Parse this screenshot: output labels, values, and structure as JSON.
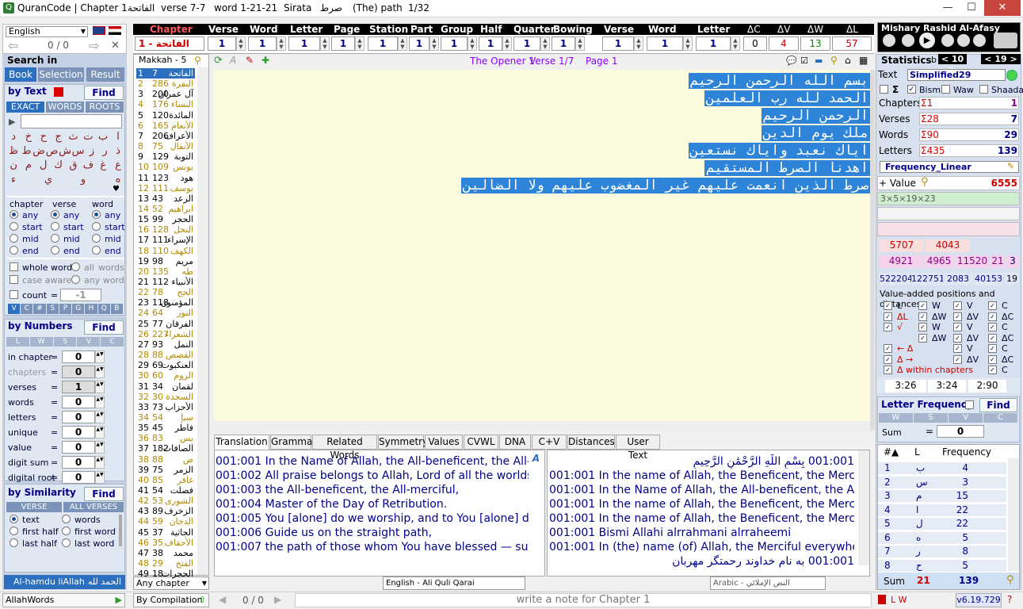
{
  "title": {
    "app": "QuranCode | Chapter 1",
    "chapter_ar": "الفاتحة",
    "verse": "verse 7-7",
    "word": "word 1-21-21",
    "sirata": "Sirata",
    "sirata_ar": "صرط",
    "path": "(The) path",
    "page": "1/32"
  },
  "window": {
    "minimize": "—",
    "maximize": "☐",
    "close": "✕"
  },
  "lang": {
    "selected": "English",
    "counter": "0 / 0"
  },
  "nav": {
    "headers": [
      "Chapter",
      "Verse",
      "Word",
      "Letter",
      "Page",
      "Station",
      "Part",
      "Group",
      "Half",
      "Quarter",
      "Bowing",
      "Verse",
      "Word",
      "Letter",
      "ΔC",
      "ΔV",
      "ΔW",
      "ΔL"
    ],
    "chapter_value": "1 - الفاتحة",
    "values": [
      "1",
      "1",
      "1",
      "1",
      "1",
      "1",
      "1",
      "1",
      "1",
      "1",
      "1",
      "1",
      "1"
    ],
    "delta_values": [
      "0",
      "4",
      "13",
      "57"
    ]
  },
  "reciter": {
    "name": "Mishary Rashid Al-Afasy"
  },
  "search": {
    "title": "Search in",
    "tabs": [
      "Book",
      "Selection",
      "Result"
    ],
    "by_text": "by Text",
    "find": "Find",
    "modes": [
      "EXACT",
      "WORDS",
      "ROOTS"
    ],
    "letters_row1": [
      "ا",
      "ب",
      "ت",
      "ث",
      "ج",
      "ح",
      "خ",
      "د"
    ],
    "letters_row2": [
      "ذ",
      "ر",
      "ز",
      "س",
      "ش",
      "ص",
      "ض",
      "ط",
      "ظ"
    ],
    "letters_row3": [
      "ع",
      "غ",
      "ف",
      "ق",
      "ك",
      "ل",
      "م",
      "ن"
    ],
    "letters_row4": [
      "ه",
      "و",
      "ي",
      "ء"
    ],
    "col_heads": [
      "chapter",
      "verse",
      "word"
    ],
    "pos_opts": [
      "any",
      "start",
      "mid",
      "end"
    ],
    "whole_word": "whole word",
    "all_words": "all",
    "words": "words",
    "case_aware": "case aware",
    "any_word": "any word",
    "count": "count",
    "count_eq": "=",
    "count_val": "-1",
    "unit_letters": [
      "V",
      "C",
      "#",
      "S",
      "P",
      "G",
      "H",
      "Q",
      "B"
    ]
  },
  "numbers": {
    "title": "by Numbers",
    "find": "Find",
    "cols": [
      "L",
      "W",
      "S",
      "V",
      "C"
    ],
    "rows": [
      {
        "label": "in chapter",
        "op": "=",
        "val": "0"
      },
      {
        "label": "chapters",
        "op": "=",
        "val": "0"
      },
      {
        "label": "verses",
        "op": "=",
        "val": "1"
      },
      {
        "label": "words",
        "op": "=",
        "val": "0"
      },
      {
        "label": "letters",
        "op": "=",
        "val": "0"
      },
      {
        "label": "unique",
        "op": "=",
        "val": "0"
      },
      {
        "label": "value",
        "op": "=",
        "val": "0"
      },
      {
        "label": "digit sum",
        "op": "=",
        "val": "0"
      },
      {
        "label": "digital root",
        "op": "=",
        "val": "0"
      }
    ]
  },
  "similarity": {
    "title": "by Similarity",
    "find": "Find",
    "tabs": [
      "VERSE",
      "ALL VERSES"
    ],
    "opts": [
      "text",
      "first half",
      "last half",
      "words",
      "first word",
      "last word"
    ]
  },
  "footer_left": {
    "label": "Al-hamdu liAllah",
    "label_ar": "الحمد لله"
  },
  "chapters_panel": {
    "header": "Makkah - 5",
    "rows": [
      [
        "1",
        "7",
        "الفاتحة"
      ],
      [
        "2",
        "286",
        "البقرة"
      ],
      [
        "3",
        "200",
        "آل عمران"
      ],
      [
        "4",
        "176",
        "النساء"
      ],
      [
        "5",
        "120",
        "المائدة"
      ],
      [
        "6",
        "165",
        "الأنعام"
      ],
      [
        "7",
        "206",
        "الأعراف"
      ],
      [
        "8",
        "75",
        "الأنفال"
      ],
      [
        "9",
        "129",
        "التوبة"
      ],
      [
        "10",
        "109",
        "يونس"
      ],
      [
        "11",
        "123",
        "هود"
      ],
      [
        "12",
        "111",
        "يوسف"
      ],
      [
        "13",
        "43",
        "الرعد"
      ],
      [
        "14",
        "52",
        "ابراهيم"
      ],
      [
        "15",
        "99",
        "الحجر"
      ],
      [
        "16",
        "128",
        "النحل"
      ],
      [
        "17",
        "111",
        "الإسراء"
      ],
      [
        "18",
        "110",
        "الكهف"
      ],
      [
        "19",
        "98",
        "مريم"
      ],
      [
        "20",
        "135",
        "طه"
      ],
      [
        "21",
        "112",
        "الأنبياء"
      ],
      [
        "22",
        "78",
        "الحج"
      ],
      [
        "23",
        "118",
        "المؤمنون"
      ],
      [
        "24",
        "64",
        "النور"
      ],
      [
        "25",
        "77",
        "الفرقان"
      ],
      [
        "26",
        "227",
        "الشعراء"
      ],
      [
        "27",
        "93",
        "النمل"
      ],
      [
        "28",
        "88",
        "القصص"
      ],
      [
        "29",
        "69",
        "العنكبوت"
      ],
      [
        "30",
        "60",
        "الروم"
      ],
      [
        "31",
        "34",
        "لقمان"
      ],
      [
        "32",
        "30",
        "السجدة"
      ],
      [
        "33",
        "73",
        "الأحزاب"
      ],
      [
        "34",
        "54",
        "سبإ"
      ],
      [
        "35",
        "45",
        "فاطر"
      ],
      [
        "36",
        "83",
        "يس"
      ],
      [
        "37",
        "182",
        "الصافات"
      ],
      [
        "38",
        "88",
        "ص"
      ],
      [
        "39",
        "75",
        "الزمر"
      ],
      [
        "40",
        "85",
        "غافر"
      ],
      [
        "41",
        "54",
        "فصلت"
      ],
      [
        "42",
        "53",
        "الشورى"
      ],
      [
        "43",
        "89",
        "الزخرف"
      ],
      [
        "44",
        "59",
        "الدخان"
      ],
      [
        "45",
        "37",
        "الجاثية"
      ],
      [
        "46",
        "35",
        "الأحقاف"
      ],
      [
        "47",
        "38",
        "محمد"
      ],
      [
        "48",
        "29",
        "الفتح"
      ],
      [
        "49",
        "18",
        "الحجرات"
      ]
    ],
    "filter": "Any chapter",
    "compilation": "By Compilation"
  },
  "info": {
    "opener": "The Opener 1",
    "verse": "Verse 1/7",
    "page": "Page 1"
  },
  "verses": [
    "بسم الله الرحمن الرحيم",
    "الحمد لله رب العلمين",
    "الرحمن الرحيم",
    "ملك يوم الدين",
    "اياك نعبد واياك نستعين",
    "اهدنا الصرط المستقيم",
    "صرط الذين انعمت عليهم غير المغضوب عليهم ولا الضالين"
  ],
  "bottom_tabs": [
    "Translation",
    "Grammar",
    "Related Words",
    "Symmetry",
    "Values",
    "CVWL",
    "DNA",
    "C+V",
    "Distances",
    "User Text"
  ],
  "translation_left": [
    "001:001 In the Name of Allah, the All-beneficent, the All-merci",
    "001:002 All praise belongs to Allah, Lord of all the worlds,",
    "001:003 the All-beneficent, the All-merciful,",
    "001:004 Master of the Day of Retribution.",
    "001:005 You [alone] do we worship, and to You [alone] do w",
    "001:006 Guide us on the straight path,",
    "001:007 the path of those whom You have blessed — such a"
  ],
  "translation_right": [
    "001:001 بِسْمِ اللَّهِ الرَّحْمَٰنِ الرَّحِيمِ",
    "001:001 In the name of Allah, the Beneficent, the Merciful.",
    "001:001 In the Name of Allah, the All-beneficent, the All-mer",
    "001:001 In the name of Allah, the Beneficent, the Merciful",
    "001:001 In the name of Allah, the Beneficent, the Merciful.",
    "001:001 Bismi Allahi alrrahmani alrraheemi",
    "001:001 In (the) name (of) Allah,  the Merciful everywhere,",
    "001:001 به نام خداوند رحمتگر مهربان"
  ],
  "translation_left_lang": "English - Ali Quli Qarai",
  "translation_right_lang": "Arabic - النص الإملائي",
  "stats": {
    "title": "Statistics",
    "b_label": "b",
    "b_val": "< 10 >",
    "c_val": "< 19 >",
    "text_label": "Text",
    "text_mode": "Simplified29",
    "bism": "Bism",
    "waw": "Waw",
    "shaada": "Shaada",
    "rows": [
      {
        "label": "Chapters",
        "sum": "Σ1",
        "val": "1"
      },
      {
        "label": "Verses",
        "sum": "Σ28",
        "val": "7"
      },
      {
        "label": "Words",
        "sum": "Σ90",
        "val": "29"
      },
      {
        "label": "Letters",
        "sum": "Σ435",
        "val": "139"
      }
    ],
    "freq_mode": "Frequency_Linear",
    "value_label": "+ Value",
    "value": "6555",
    "factors": "3×5×19×23",
    "grid1": [
      "5707",
      "4043"
    ],
    "grid2": [
      "4921",
      "4965",
      "11520",
      "21",
      "3"
    ],
    "grid3": [
      "522204",
      "122751",
      "2083",
      "401536",
      "19"
    ],
    "va_title": "Value-added positions and distances",
    "va_items": [
      "L",
      "W",
      "V",
      "C",
      "ΔL",
      "ΔW",
      "ΔV",
      "ΔC",
      "√",
      "W",
      "V",
      "C",
      "ΔW",
      "ΔV",
      "ΔC",
      "← Δ",
      "V",
      "C",
      "Δ →",
      "ΔV",
      "ΔC",
      "Δ within chapters",
      "C"
    ],
    "times": [
      "3:26",
      "3:24",
      "2:90"
    ]
  },
  "letter_freq": {
    "title": "Letter Frequency",
    "find": "Find",
    "cols": [
      "W",
      "S",
      "V",
      "C"
    ],
    "sum_label": "Sum",
    "sum_op": "=",
    "sum_val": "0",
    "head": [
      "#▲",
      "L",
      "Frequency"
    ],
    "rows": [
      [
        "1",
        "ب",
        "4"
      ],
      [
        "2",
        "س",
        "3"
      ],
      [
        "3",
        "م",
        "15"
      ],
      [
        "4",
        "ا",
        "22"
      ],
      [
        "5",
        "ل",
        "22"
      ],
      [
        "6",
        "ه",
        "5"
      ],
      [
        "7",
        "ر",
        "8"
      ],
      [
        "8",
        "ح",
        "5"
      ]
    ],
    "total_label": "Sum",
    "total_a": "21",
    "total_b": "139"
  },
  "status": {
    "left": "AllahWords",
    "counter": "0 / 0",
    "note": "write a note for Chapter 1",
    "version": "v6.19.729",
    "lw": "L W"
  }
}
